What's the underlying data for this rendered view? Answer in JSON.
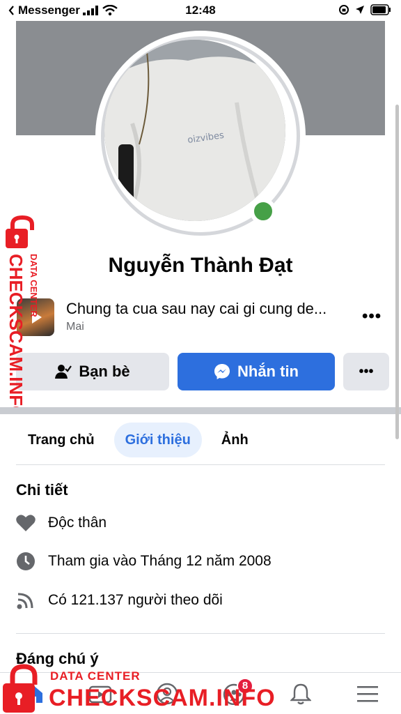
{
  "status_bar": {
    "back_app": "Messenger",
    "time": "12:48"
  },
  "profile": {
    "name": "Nguyễn Thành Đạt",
    "avatar_shirt_text": "oizvibes",
    "online_color": "#46a047"
  },
  "music": {
    "title": "Chung ta cua sau nay cai gi cung de...",
    "artist": "Mai",
    "more_label": "•••"
  },
  "actions": {
    "friends_label": "Bạn bè",
    "message_label": "Nhắn tin",
    "more_label": "•••"
  },
  "tabs": [
    {
      "label": "Trang chủ",
      "active": false
    },
    {
      "label": "Giới thiệu",
      "active": true
    },
    {
      "label": "Ảnh",
      "active": false
    }
  ],
  "details": {
    "title": "Chi tiết",
    "items": [
      {
        "icon": "heart-icon",
        "text": "Độc thân"
      },
      {
        "icon": "clock-icon",
        "text": "Tham gia vào Tháng 12 năm 2008"
      },
      {
        "icon": "rss-icon",
        "text": "Có 121.137 người theo dõi"
      }
    ]
  },
  "notable": {
    "title": "Đáng chú ý"
  },
  "bottom_nav": {
    "items": [
      {
        "icon": "home-icon"
      },
      {
        "icon": "watch-icon"
      },
      {
        "icon": "profile-icon"
      },
      {
        "icon": "groups-icon",
        "badge": "8"
      },
      {
        "icon": "bell-icon"
      },
      {
        "icon": "menu-icon"
      }
    ]
  },
  "watermark": {
    "side_text": "CHECKSCAM.INFO",
    "side_small": "DATA CENTER",
    "bottom_small": "DATA CENTER",
    "bottom_big": "CHECKSCAM.INFO"
  },
  "colors": {
    "accent": "#2d6fde",
    "watermark": "#e81e25",
    "badge": "#e41e3f"
  }
}
